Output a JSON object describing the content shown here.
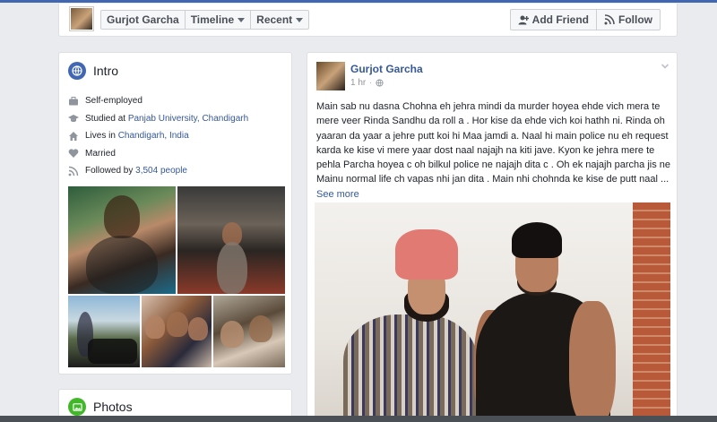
{
  "header": {
    "name": "Gurjot Garcha",
    "tab_timeline": "Timeline",
    "tab_recent": "Recent",
    "add_friend": "Add Friend",
    "follow": "Follow"
  },
  "intro": {
    "title": "Intro",
    "items": [
      {
        "icon": "briefcase-icon",
        "text": "Self-employed",
        "link": ""
      },
      {
        "icon": "graduation-cap-icon",
        "text": "Studied at ",
        "link": "Panjab University, Chandigarh"
      },
      {
        "icon": "house-icon",
        "text": "Lives in ",
        "link": "Chandigarh, India"
      },
      {
        "icon": "heart-icon",
        "text": "Married",
        "link": ""
      },
      {
        "icon": "followers-icon",
        "text": "Followed by ",
        "link": "3,504 people"
      }
    ]
  },
  "photos": {
    "title": "Photos"
  },
  "post": {
    "author": "Gurjot Garcha",
    "time": "1 hr",
    "text": "Main sab nu dasna Chohna eh jehra mindi da murder hoyea ehde vich mera te mere veer Rinda Sandhu da roll a . Hor kise da ehde vich koi hathh ni. Rinda oh yaaran da yaar a jehre putt koi hi Maa jamdi a. Naal hi main police nu eh request karda ke kise vi mere yaar dost naal najajh na kiti jave. Kyon ke jehra mere te pehla Parcha hoyea c oh bilkul police ne najajh dita c . Oh ek najajh parcha jis ne Mainu normal life ch vapas nhi jan dita . Main nhi chohnda ke kise de putt naal ... ",
    "see_more": "See more"
  }
}
